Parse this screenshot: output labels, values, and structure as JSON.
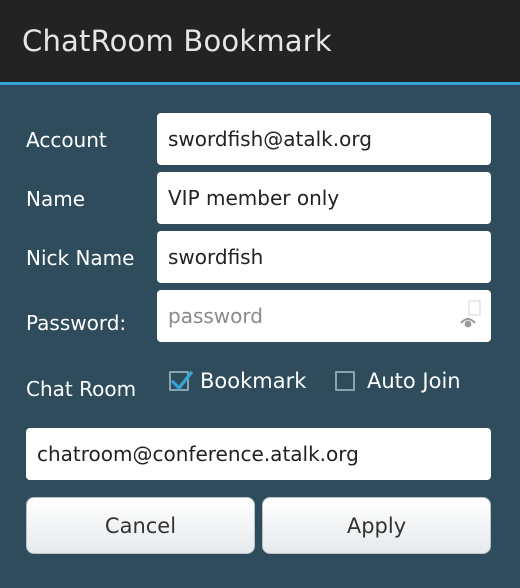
{
  "dialog": {
    "title": "ChatRoom Bookmark"
  },
  "form": {
    "account": {
      "label": "Account",
      "value": "swordfish@atalk.org"
    },
    "name": {
      "label": "Name",
      "value": "VIP member only"
    },
    "nick": {
      "label": "Nick Name",
      "value": "swordfish"
    },
    "password": {
      "label": "Password:",
      "value": "",
      "placeholder": "password",
      "toggle_icon": "eye-icon"
    },
    "chat_room": {
      "label": "Chat Room",
      "bookmark": {
        "label": "Bookmark",
        "checked": true
      },
      "auto_join": {
        "label": "Auto Join",
        "checked": false
      },
      "value": "chatroom@conference.atalk.org"
    }
  },
  "buttons": {
    "cancel": "Cancel",
    "apply": "Apply"
  },
  "colors": {
    "background": "#2e4c5c",
    "titlebar": "#232323",
    "accent": "#33a5d5"
  }
}
